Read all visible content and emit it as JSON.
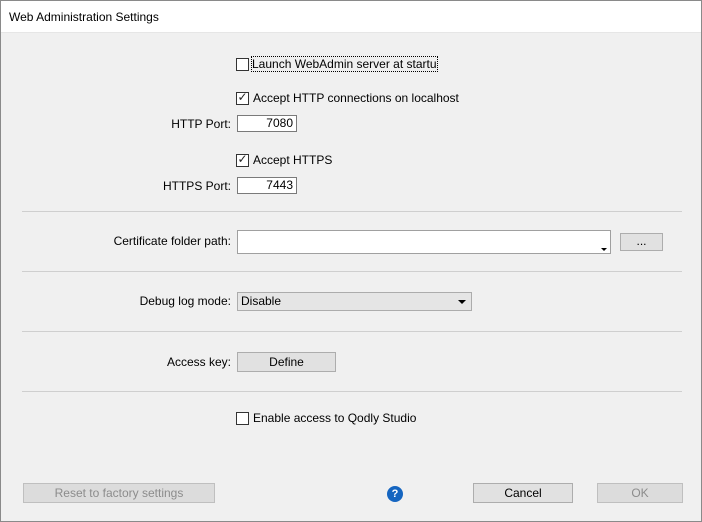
{
  "window": {
    "title": "Web Administration Settings"
  },
  "launch": {
    "label": "Launch WebAdmin server at startu",
    "checked": false
  },
  "http": {
    "accept_label": "Accept HTTP connections on localhost",
    "accept_checked": true,
    "port_label": "HTTP Port:",
    "port_value": "7080"
  },
  "https": {
    "accept_label": "Accept HTTPS",
    "accept_checked": true,
    "port_label": "HTTPS Port:",
    "port_value": "7443"
  },
  "certificate": {
    "label": "Certificate folder path:",
    "value": "",
    "browse_label": "..."
  },
  "debug": {
    "label": "Debug log mode:",
    "value": "Disable"
  },
  "access_key": {
    "label": "Access key:",
    "button_label": "Define"
  },
  "qodly": {
    "label": "Enable access to Qodly Studio",
    "checked": false
  },
  "footer": {
    "reset_label": "Reset to factory settings",
    "help_glyph": "?",
    "cancel_label": "Cancel",
    "ok_label": "OK"
  },
  "check_glyph": "✓"
}
